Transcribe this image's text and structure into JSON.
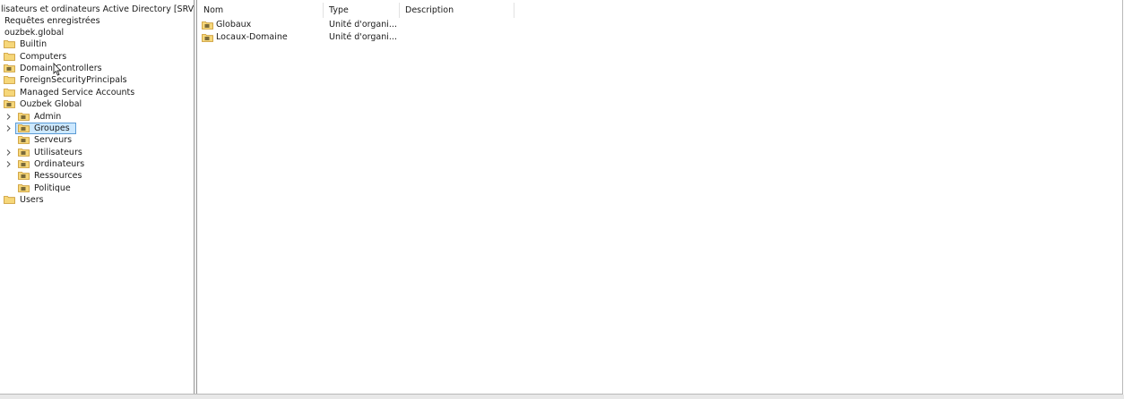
{
  "tree": {
    "root_label": "lisateurs et ordinateurs Active Directory [SRV-PD",
    "saved_queries": "Requêtes enregistrées",
    "domain": "ouzbek.global",
    "nodes": [
      {
        "label": "Builtin",
        "type": "container"
      },
      {
        "label": "Computers",
        "type": "container"
      },
      {
        "label": "Domain Controllers",
        "type": "ou"
      },
      {
        "label": "ForeignSecurityPrincipals",
        "type": "container"
      },
      {
        "label": "Managed Service Accounts",
        "type": "container"
      },
      {
        "label": "Ouzbek Global",
        "type": "ou"
      },
      {
        "label": "Admin",
        "type": "ou",
        "expandable": true
      },
      {
        "label": "Groupes",
        "type": "ou",
        "expandable": true,
        "selected": true
      },
      {
        "label": "Serveurs",
        "type": "ou"
      },
      {
        "label": "Utilisateurs",
        "type": "ou",
        "expandable": true
      },
      {
        "label": "Ordinateurs",
        "type": "ou",
        "expandable": true
      },
      {
        "label": "Ressources",
        "type": "ou"
      },
      {
        "label": "Politique",
        "type": "ou"
      },
      {
        "label": "Users",
        "type": "container"
      }
    ]
  },
  "list": {
    "columns": [
      "Nom",
      "Type",
      "Description"
    ],
    "rows": [
      {
        "name": "Globaux",
        "type": "Unité d'organi...",
        "description": ""
      },
      {
        "name": "Locaux-Domaine",
        "type": "Unité d'organi...",
        "description": ""
      }
    ]
  },
  "colors": {
    "folder": "#e8b84a",
    "folder_dark": "#c8962c",
    "selection": "#cce8ff",
    "selection_border": "#5b9bd5"
  }
}
